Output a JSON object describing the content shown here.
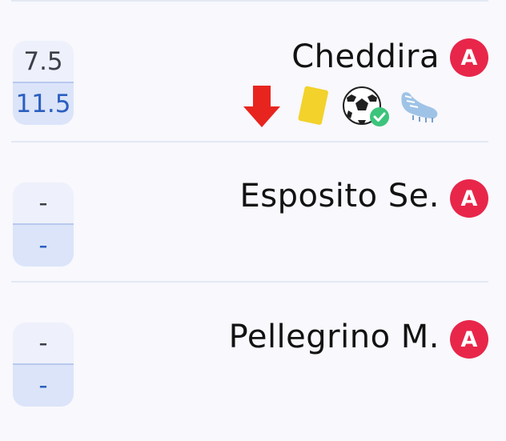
{
  "players": [
    {
      "name": "Cheddira",
      "vote_top": "7.5",
      "vote_bottom": "11.5",
      "badge": "A",
      "events": [
        "substituted-out-arrow-icon",
        "yellow-card-icon",
        "goal-ball-icon",
        "boot-assist-icon"
      ]
    },
    {
      "name": "Esposito Se.",
      "vote_top": "-",
      "vote_bottom": "-",
      "badge": "A"
    },
    {
      "name": "Pellegrino M.",
      "vote_top": "-",
      "vote_bottom": "-",
      "badge": "A"
    }
  ],
  "colors": {
    "badge": "#e8264a",
    "bottom_vote_text": "#2b5fc0",
    "yellow_card": "#f2d22b",
    "down_arrow": "#e8241f",
    "check": "#3cc47c"
  }
}
